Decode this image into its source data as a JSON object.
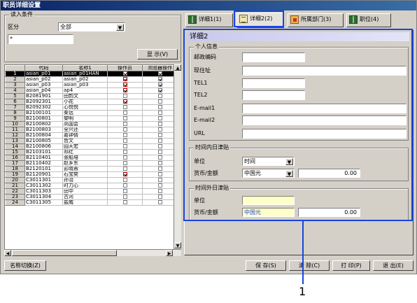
{
  "window": {
    "title": "职员详细设置"
  },
  "filter": {
    "legend": "读入条件",
    "category_label": "区分",
    "category_value": "全部",
    "search_value": "*",
    "show_button": "显 示(V)"
  },
  "grid": {
    "headers": [
      "代码",
      "名称1",
      "操作员",
      "浏览器操作"
    ],
    "rows": [
      {
        "n": "1",
        "code": "asian_p01",
        "name": "asian_p01HAN",
        "op": "on",
        "br": "on",
        "selected": true
      },
      {
        "n": "2",
        "code": "asian_p02",
        "name": "asian_p02",
        "op": "red",
        "br": "on"
      },
      {
        "n": "3",
        "code": "asian_p03",
        "name": "asian_p03",
        "op": "red",
        "br": "on"
      },
      {
        "n": "4",
        "code": "asian_p04",
        "name": "ap4",
        "op": "red",
        "br": "on"
      },
      {
        "n": "5",
        "code": "B2081901",
        "name": "田韵文",
        "op": "off",
        "br": "off"
      },
      {
        "n": "6",
        "code": "B2092301",
        "name": "小花",
        "op": "red",
        "br": "off"
      },
      {
        "n": "7",
        "code": "B2092302",
        "name": "心悦悦",
        "op": "off",
        "br": "off"
      },
      {
        "n": "8",
        "code": "B2100101",
        "name": "秦远",
        "op": "off",
        "br": "off"
      },
      {
        "n": "9",
        "code": "B2100801",
        "name": "黎明",
        "op": "off",
        "br": "off"
      },
      {
        "n": "10",
        "code": "B2100802",
        "name": "高国会",
        "op": "off",
        "br": "off"
      },
      {
        "n": "11",
        "code": "B2100803",
        "name": "全兴还",
        "op": "off",
        "br": "off"
      },
      {
        "n": "12",
        "code": "B2100804",
        "name": "葛钟倩",
        "op": "off",
        "br": "off"
      },
      {
        "n": "13",
        "code": "B2100805",
        "name": "皆文",
        "op": "off",
        "br": "off"
      },
      {
        "n": "14",
        "code": "B2100806",
        "name": "园天宏",
        "op": "off",
        "br": "off"
      },
      {
        "n": "15",
        "code": "B2103101",
        "name": "祁红",
        "op": "off",
        "br": "off"
      },
      {
        "n": "16",
        "code": "B2110401",
        "name": "张船培",
        "op": "off",
        "br": "off"
      },
      {
        "n": "17",
        "code": "B2110402",
        "name": "赵乡东",
        "op": "off",
        "br": "off"
      },
      {
        "n": "18",
        "code": "B2120101",
        "name": "彭晓蓉",
        "op": "off",
        "br": "off"
      },
      {
        "n": "19",
        "code": "B2120901",
        "name": "石宝奕",
        "op": "red",
        "br": "off"
      },
      {
        "n": "20",
        "code": "C3011301",
        "name": "孙治",
        "op": "off",
        "br": "off"
      },
      {
        "n": "21",
        "code": "C3011302",
        "name": "时力心",
        "op": "off",
        "br": "off"
      },
      {
        "n": "22",
        "code": "C3011303",
        "name": "田中",
        "op": "off",
        "br": "off"
      },
      {
        "n": "23",
        "code": "C3011304",
        "name": "古河",
        "op": "off",
        "br": "off"
      },
      {
        "n": "24",
        "code": "C3011305",
        "name": "盐威",
        "op": "off",
        "br": "off"
      }
    ]
  },
  "tabs": [
    {
      "label": "详细1(1)",
      "icon": "book-icon"
    },
    {
      "label": "详细2(2)",
      "icon": "document-icon",
      "active": true
    },
    {
      "label": "所属部门(3)",
      "icon": "folder-icon"
    },
    {
      "label": "职位(4)",
      "icon": "book-icon"
    }
  ],
  "detail": {
    "title": "详细2",
    "personal": {
      "legend": "个人信息",
      "fields": [
        {
          "label": "邮政编码",
          "value": ""
        },
        {
          "label": "现住址",
          "value": ""
        },
        {
          "label": "TEL1",
          "value": ""
        },
        {
          "label": "TEL2",
          "value": ""
        },
        {
          "label": "E-mail1",
          "value": ""
        },
        {
          "label": "E-mail2",
          "value": ""
        },
        {
          "label": "URL",
          "value": ""
        }
      ]
    },
    "in_hours": {
      "legend": "时间内日津贴",
      "unit_label": "单位",
      "unit_value": "时间",
      "currency_label": "货币/金额",
      "currency_value": "中国元",
      "amount": "0.00"
    },
    "out_hours": {
      "legend": "时间外日津贴",
      "unit_label": "单位",
      "unit_value": "",
      "currency_label": "货币/金额",
      "currency_value": "中国元",
      "amount": "0.00"
    }
  },
  "footer": {
    "name_toggle": "名称切换(Z)",
    "save": "保 存(S)",
    "clear": "清 除(C)",
    "print": "打 印(P)",
    "exit": "退 出(E)"
  },
  "annotation": {
    "label": "1",
    "color": "#1a44e0"
  }
}
